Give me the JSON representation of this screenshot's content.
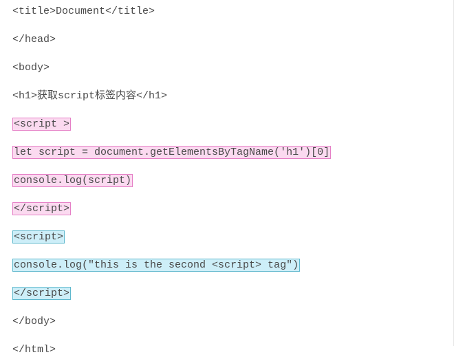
{
  "lines": {
    "l1": "<title>Document</title>",
    "l2": "</head>",
    "l3": "<body>",
    "l4": "<h1>获取script标签内容</h1>",
    "l5": "<script >",
    "l6": "let script = document.getElementsByTagName('h1')[0]",
    "l7": "console.log(script)",
    "l8": "</script>",
    "l9": "<script>",
    "l10": "console.log(\"this is the second <script> tag\")",
    "l11": "</script>",
    "l12": "</body>",
    "l13": "</html>"
  }
}
